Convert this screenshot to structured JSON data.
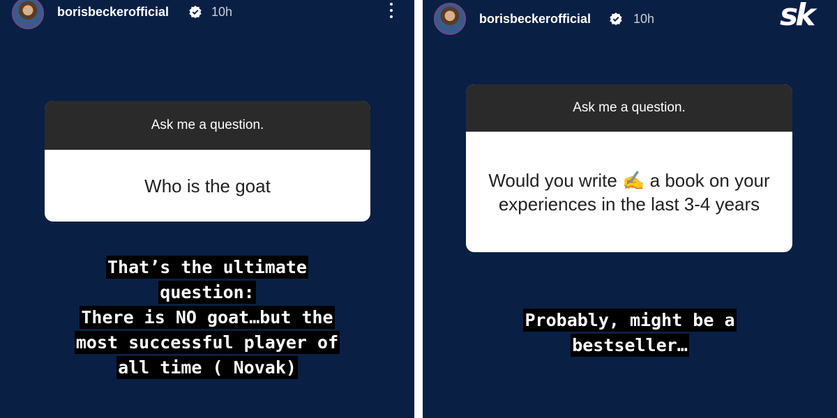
{
  "left_story": {
    "username": "borisbeckerofficial",
    "time": "10h",
    "card": {
      "header": "Ask me a question.",
      "question": "Who is the goat"
    },
    "reply_lines": [
      "That’s the ultimate",
      "question:",
      "There is NO goat…but the",
      "most successful player of",
      "all time ( Novak)"
    ]
  },
  "right_story": {
    "username": "borisbeckerofficial",
    "time": "10h",
    "card": {
      "header": "Ask me a question.",
      "question": "Would you write ✍️ a book on your experiences in the last 3-4 years"
    },
    "reply_lines": [
      "Probably, might be a",
      "bestseller…"
    ]
  },
  "logo_text": "sk",
  "colors": {
    "background": "#0a1f44",
    "card_header": "#2a2a2a",
    "card_body": "#ffffff",
    "reply_highlight": "#000000"
  },
  "icons": [
    "verified-badge-icon",
    "more-options-icon"
  ]
}
